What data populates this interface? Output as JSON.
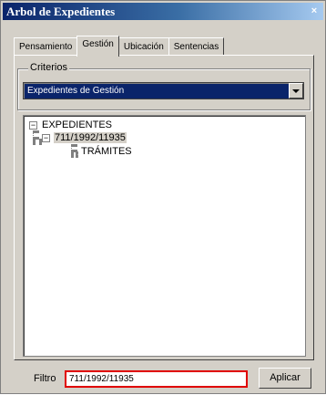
{
  "window": {
    "title": "Arbol de Expedientes",
    "close_label": "×"
  },
  "tabs": [
    {
      "label": "Pensamiento"
    },
    {
      "label": "Gestión"
    },
    {
      "label": "Ubicación"
    },
    {
      "label": "Sentencias"
    }
  ],
  "criteria": {
    "legend": "Criterios",
    "selected": "Expedientes de Gestión"
  },
  "tree": {
    "root": {
      "expander": "−",
      "label": "EXPEDIENTES"
    },
    "child": {
      "expander": "−",
      "label": "711/1992/11935"
    },
    "grandchild": {
      "label": "TRÁMITES"
    }
  },
  "filter": {
    "label": "Filtro",
    "value": "711/1992/11935",
    "apply_label": "Aplicar"
  }
}
